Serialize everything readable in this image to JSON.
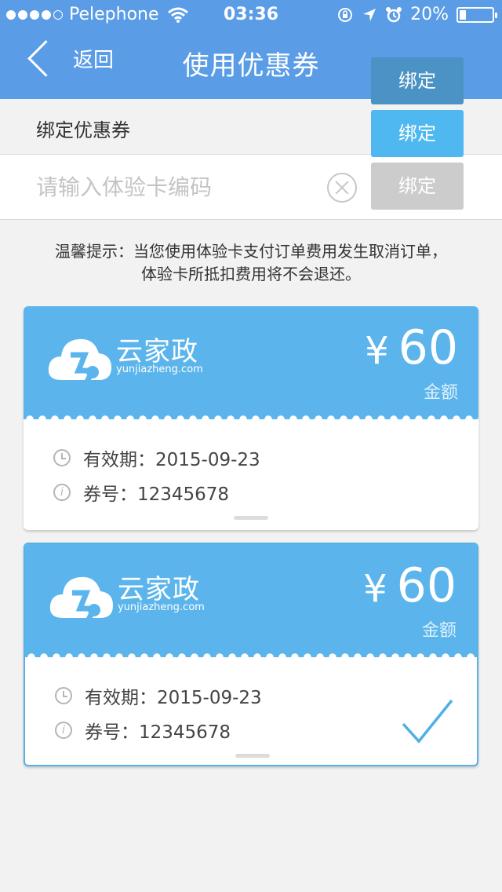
{
  "status_bar": {
    "carrier": "Pelephone",
    "time": "03:36",
    "battery": "20%",
    "battery_level": 0.2
  },
  "nav": {
    "back_label": "返回",
    "title": "使用优惠券"
  },
  "bind_section": {
    "label": "绑定优惠券",
    "input_placeholder": "请输入体验卡编码",
    "button_states": [
      "绑定",
      "绑定",
      "绑定"
    ]
  },
  "tip": {
    "line1": "温馨提示：当您使用体验卡支付订单费用发生取消订单，",
    "line2": "体验卡所抵扣费用将不会退还。"
  },
  "coupons": [
    {
      "brand": "云家政",
      "domain": "yunjiazheng.com",
      "currency": "¥",
      "amount": "60",
      "amount_label": "金额",
      "validity": "有效期：2015-09-23",
      "number": "券号：12345678",
      "selected": false
    },
    {
      "brand": "云家政",
      "domain": "yunjiazheng.com",
      "currency": "¥",
      "amount": "60",
      "amount_label": "金额",
      "validity": "有效期：2015-09-23",
      "number": "券号：12345678",
      "selected": true
    }
  ],
  "colors": {
    "nav_bg": "#5a9ce6",
    "coupon_head": "#5bb5ec",
    "bind_pressed": "#4a93c4",
    "bind_normal": "#4fb8f0",
    "bind_disabled": "#cccccc",
    "check": "#4fb0e6"
  }
}
